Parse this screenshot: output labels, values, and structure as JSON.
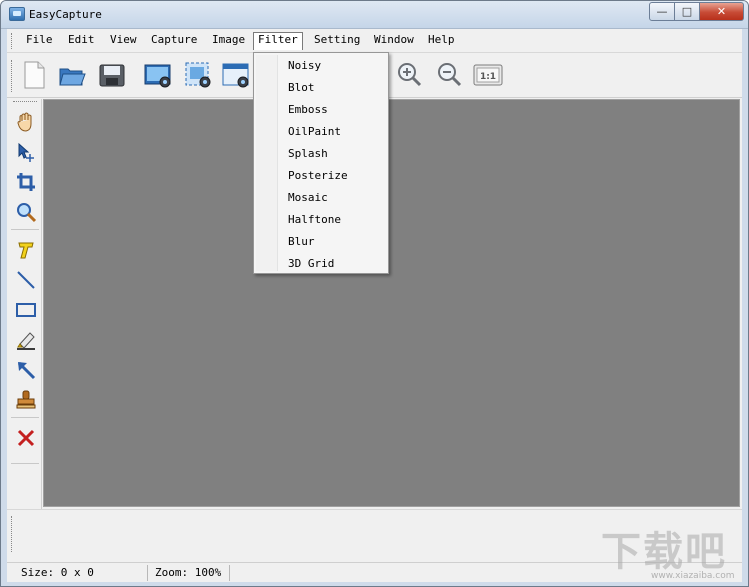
{
  "window": {
    "title": "EasyCapture",
    "min_glyph": "—",
    "max_glyph": "□",
    "close_glyph": "✕"
  },
  "menubar": {
    "items": [
      {
        "label": "File"
      },
      {
        "label": "Edit"
      },
      {
        "label": "View"
      },
      {
        "label": "Capture"
      },
      {
        "label": "Image"
      },
      {
        "label": "Filter"
      },
      {
        "label": "Setting"
      },
      {
        "label": "Window"
      },
      {
        "label": "Help"
      }
    ],
    "active": "Filter"
  },
  "toolbar": {
    "buttons": [
      {
        "icon": "new-file-icon"
      },
      {
        "icon": "open-folder-icon"
      },
      {
        "icon": "save-icon"
      },
      {
        "icon": "capture-screen-icon"
      },
      {
        "icon": "capture-region-icon"
      },
      {
        "icon": "capture-window-icon"
      },
      {
        "icon": "zoom-in-icon"
      },
      {
        "icon": "zoom-out-icon"
      },
      {
        "icon": "actual-size-icon",
        "text": "1:1"
      }
    ]
  },
  "tools": [
    {
      "icon": "hand-icon"
    },
    {
      "icon": "move-select-icon"
    },
    {
      "icon": "crop-icon"
    },
    {
      "icon": "magnifier-icon"
    },
    {
      "icon": "text-tool-icon"
    },
    {
      "icon": "line-tool-icon"
    },
    {
      "icon": "rectangle-tool-icon"
    },
    {
      "icon": "highlighter-icon"
    },
    {
      "icon": "arrow-tool-icon"
    },
    {
      "icon": "stamp-icon"
    },
    {
      "icon": "delete-icon"
    }
  ],
  "filter_menu": {
    "items": [
      "Noisy",
      "Blot",
      "Emboss",
      "OilPaint",
      "Splash",
      "Posterize",
      "Mosaic",
      "Halftone",
      "Blur",
      "3D Grid"
    ]
  },
  "status": {
    "size": "Size: 0 x 0",
    "zoom": "Zoom: 100%"
  },
  "watermark": {
    "main": "下载吧",
    "sub": "www.xiazaiba.com"
  },
  "colors": {
    "canvas": "#808080",
    "window_frame": "#cfdbea",
    "close_button": "#c74b36",
    "client": "#f0f0f0"
  }
}
